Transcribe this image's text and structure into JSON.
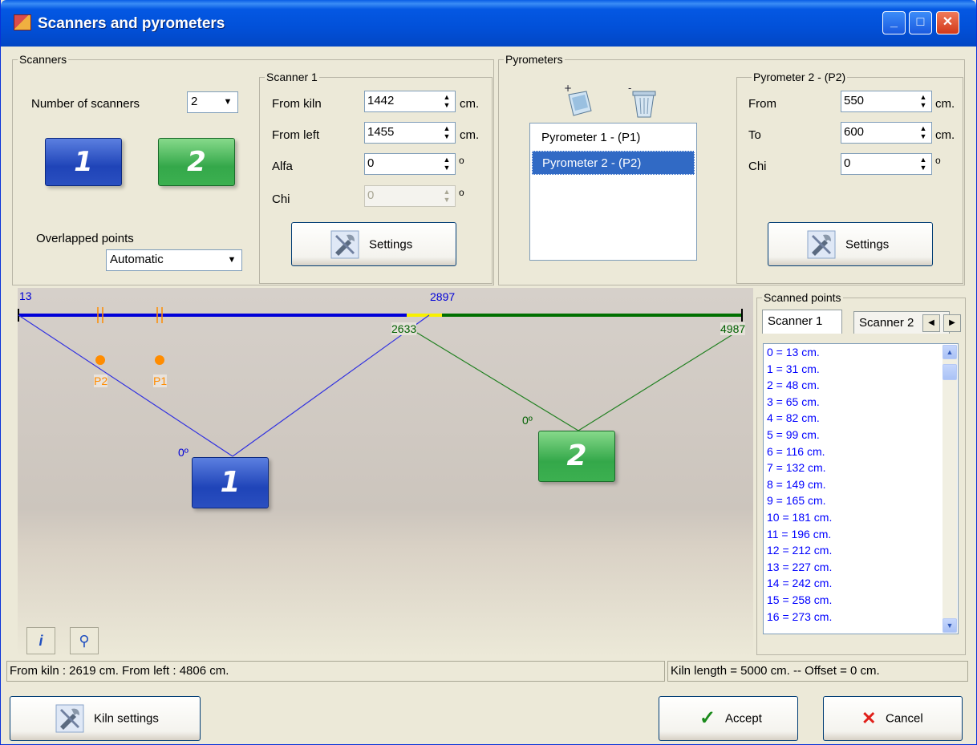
{
  "window": {
    "title": "Scanners and pyrometers"
  },
  "scanners": {
    "group_label": "Scanners",
    "number_label": "Number of scanners",
    "number_value": "2",
    "tiles": [
      "1",
      "2"
    ],
    "overlapped_label": "Overlapped points",
    "overlapped_value": "Automatic"
  },
  "scanner1": {
    "group_label": "Scanner 1",
    "from_kiln_label": "From kiln",
    "from_kiln_value": "1442",
    "from_kiln_unit": "cm.",
    "from_left_label": "From left",
    "from_left_value": "1455",
    "from_left_unit": "cm.",
    "alfa_label": "Alfa",
    "alfa_value": "0",
    "alfa_unit": "o",
    "chi_label": "Chi",
    "chi_value": "0",
    "chi_unit": "o",
    "settings_label": "Settings"
  },
  "pyrometers": {
    "group_label": "Pyrometers",
    "items": [
      "Pyrometer 1 - (P1)",
      "Pyrometer 2 - (P2)"
    ],
    "selected_index": 1
  },
  "pyrometer2": {
    "group_label": "Pyrometer 2 - (P2)",
    "from_label": "From",
    "from_value": "550",
    "from_unit": "cm.",
    "to_label": "To",
    "to_value": "600",
    "to_unit": "cm.",
    "chi_label": "Chi",
    "chi_value": "0",
    "chi_unit": "o",
    "settings_label": "Settings"
  },
  "diagram": {
    "start_label": "13",
    "scanner1_end_label": "2897",
    "scanner2_start_label": "2633",
    "end_label": "4987",
    "p1_label": "P1",
    "p2_label": "P2",
    "angle1_label": "0º",
    "angle2_label": "0º",
    "tile1": "1",
    "tile2": "2",
    "colors": {
      "scanner1": "#0000d8",
      "scanner2": "#007000",
      "overlap": "#f8f000",
      "pyrometer": "#ff8c00"
    }
  },
  "scanned_points": {
    "group_label": "Scanned points",
    "tabs": [
      "Scanner 1",
      "Scanner 2"
    ],
    "items": [
      "0 = 13 cm.",
      "1 = 31 cm.",
      "2 = 48 cm.",
      "3 = 65 cm.",
      "4 = 82 cm.",
      "5 = 99 cm.",
      "6 = 116 cm.",
      "7 = 132 cm.",
      "8 = 149 cm.",
      "9 = 165 cm.",
      "10 = 181 cm.",
      "11 = 196 cm.",
      "12 = 212 cm.",
      "13 = 227 cm.",
      "14 = 242 cm.",
      "15 = 258 cm.",
      "16 = 273 cm."
    ]
  },
  "status": {
    "left": "From kiln : 2619 cm. From left : 4806 cm.",
    "right": "Kiln length = 5000 cm. -- Offset = 0 cm."
  },
  "footer": {
    "kiln_settings_label": "Kiln settings",
    "accept_label": "Accept",
    "cancel_label": "Cancel"
  }
}
